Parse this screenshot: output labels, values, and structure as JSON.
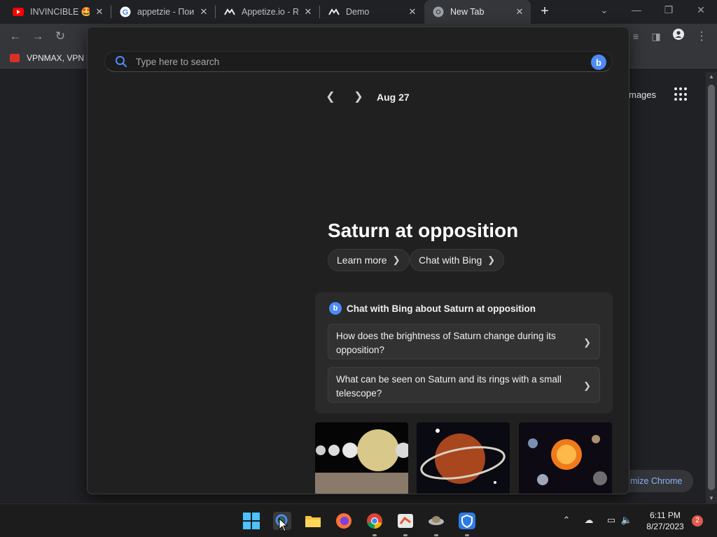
{
  "browser": {
    "tabs": [
      {
        "title": "INVINCIBLE 🤩",
        "icon": "youtube-icon"
      },
      {
        "title": "appetzie - Поис",
        "icon": "google-icon"
      },
      {
        "title": "Appetize.io - Ru",
        "icon": "appetize-icon"
      },
      {
        "title": "Demo",
        "icon": "appetize-icon"
      },
      {
        "title": "New Tab",
        "icon": "chrome-icon",
        "active": true
      }
    ],
    "bookmarks": [
      {
        "label": "VPNMAX, VPN &"
      }
    ]
  },
  "ntp": {
    "images_link": "mages",
    "customize_label": "mize Chrome"
  },
  "flyout": {
    "search_placeholder": "Type here to search",
    "date": "Aug 27",
    "hero_title": "Saturn at opposition",
    "learn_more": "Learn more",
    "chat_with_bing": "Chat with Bing",
    "chat_card": {
      "header": "Chat with Bing about Saturn at opposition",
      "questions": [
        "How does the brightness of Saturn change during its opposition?",
        "What can be seen on Saturn and its rings with a small telescope?"
      ]
    }
  },
  "taskbar": {
    "time": "6:11 PM",
    "date": "8/27/2023",
    "notifications": "2"
  },
  "colors": {
    "accent_blue": "#4c8bf5",
    "link_blue": "#8ab4f8",
    "flyout_bg": "#202020"
  }
}
